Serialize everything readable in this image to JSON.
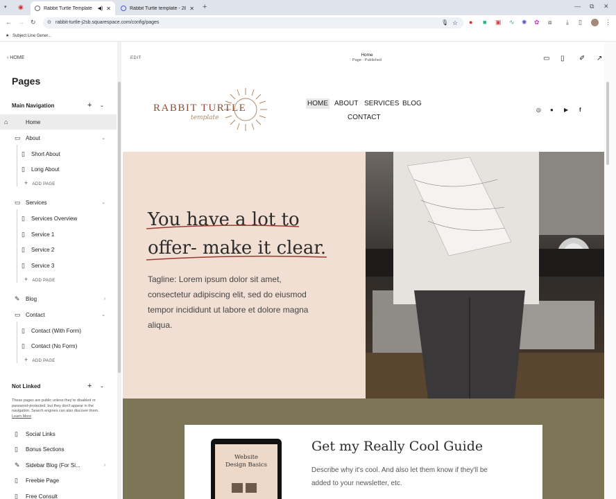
{
  "browser": {
    "tabs": [
      {
        "title": "Rabbit Turtle Template",
        "active": true
      },
      {
        "title": "Rabbit Turtle template - 28 N...",
        "active": false
      }
    ],
    "url": "rabbit-turtle-j2sb.squarespace.com/config/pages",
    "bookmark": "Subject Line Gener..."
  },
  "sidebar": {
    "back_label": "HOME",
    "title": "Pages",
    "main_nav_label": "Main Navigation",
    "items": [
      {
        "label": "Home"
      },
      {
        "label": "About"
      },
      {
        "label": "Short About"
      },
      {
        "label": "Long About"
      },
      {
        "label": "ADD PAGE"
      },
      {
        "label": "Services"
      },
      {
        "label": "Services Overview"
      },
      {
        "label": "Service 1"
      },
      {
        "label": "Service 2"
      },
      {
        "label": "Service 3"
      },
      {
        "label": "ADD PAGE"
      },
      {
        "label": "Blog"
      },
      {
        "label": "Contact"
      },
      {
        "label": "Contact (With Form)"
      },
      {
        "label": "Contact (No Form)"
      },
      {
        "label": "ADD PAGE"
      }
    ],
    "not_linked_label": "Not Linked",
    "not_linked_desc": "These pages are public unless they're disabled or password-protected, but they don't appear in the navigation. Search engines can also discover them.",
    "learn_more": "Learn More",
    "not_linked_items": [
      {
        "label": "Social Links"
      },
      {
        "label": "Bonus Sections"
      },
      {
        "label": "Sidebar Blog (For Si..."
      },
      {
        "label": "Freebie Page"
      },
      {
        "label": "Free Consult"
      }
    ]
  },
  "editor": {
    "edit_label": "EDIT",
    "page_name": "Home",
    "page_status": "Page · Published"
  },
  "site": {
    "logo_main": "RABBIT TURTLE",
    "logo_script": "template",
    "nav": [
      "HOME",
      "ABOUT",
      "SERVICES",
      "BLOG",
      "CONTACT"
    ],
    "hero_heading_line1": "You have a lot to",
    "hero_heading_line2": "offer- make it clear.",
    "hero_tagline": "Tagline: Lorem ipsum dolor sit amet, consectetur adipiscing elit, sed do eiusmod tempor incididunt ut labore et dolore magna aliqua.",
    "guide_title": "Get my Really Cool Guide",
    "guide_desc": "Describe why it's cool. And also let them know if they'll be added to your newsletter, etc.",
    "tablet_text_line1": "Website",
    "tablet_text_line2": "Design Basics"
  }
}
